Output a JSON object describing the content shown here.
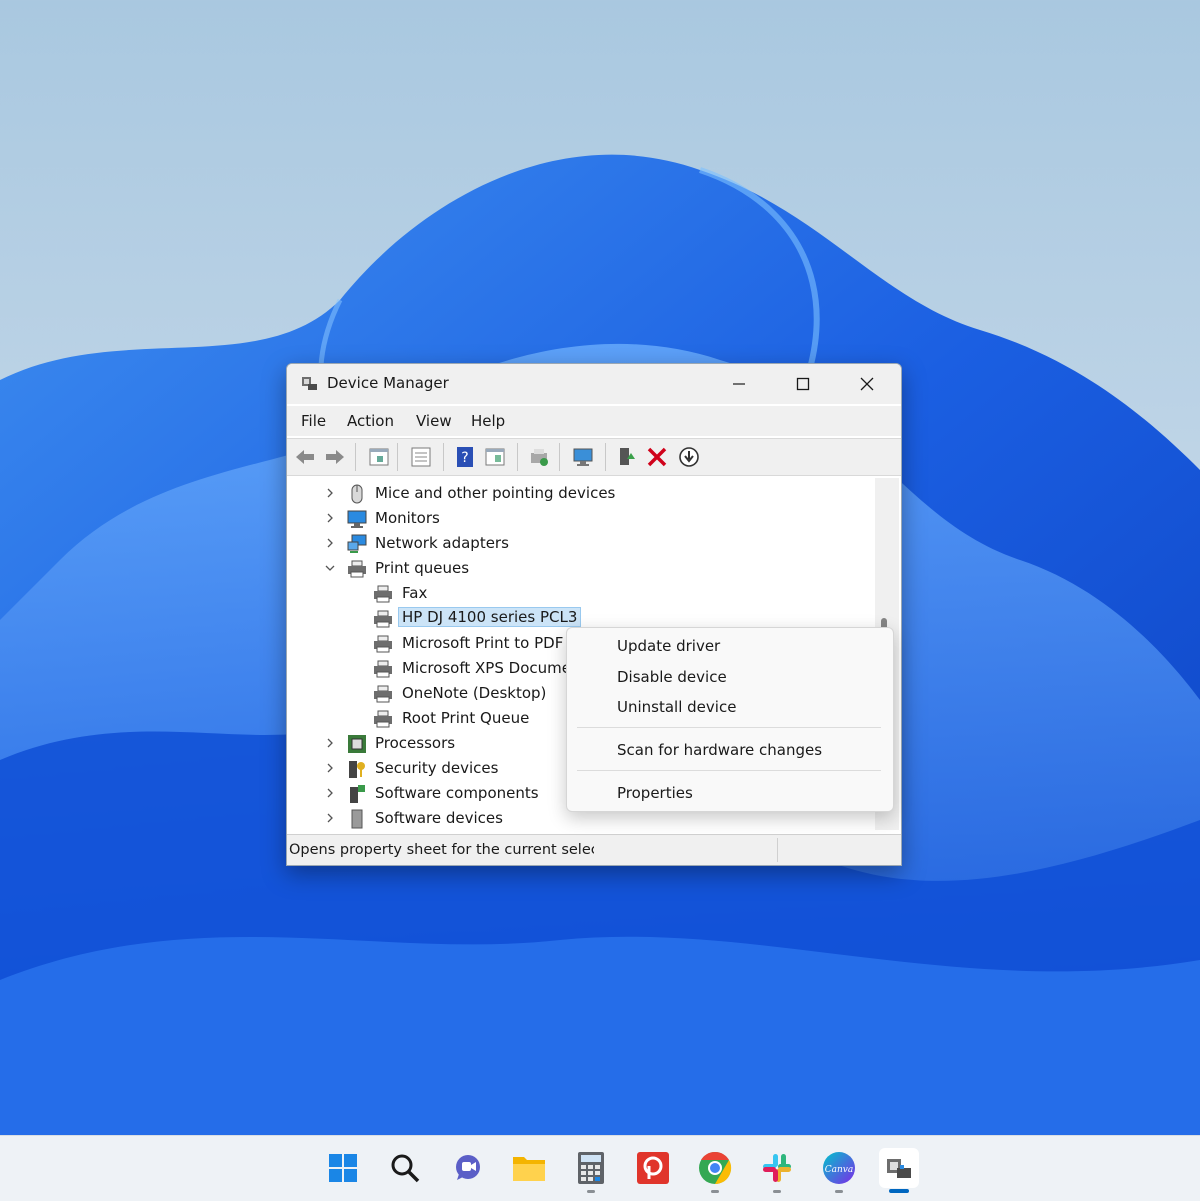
{
  "window": {
    "title": "Device Manager",
    "controls": {
      "minimize": "minimize-icon",
      "maximize": "maximize-icon",
      "close": "close-icon"
    }
  },
  "menu": [
    "File",
    "Action",
    "View",
    "Help"
  ],
  "toolbar": [
    "back-arrow-icon",
    "forward-arrow-icon",
    "properties-icon",
    "show-hide-tree-icon",
    "help-icon",
    "view-icon",
    "update-driver-icon",
    "scan-hardware-icon",
    "enable-device-icon",
    "uninstall-icon",
    "disable-device-icon"
  ],
  "tree": {
    "items": [
      {
        "label": "Mice and other pointing devices",
        "icon": "mouse-icon",
        "expanded": false,
        "level": 0
      },
      {
        "label": "Monitors",
        "icon": "monitor-icon",
        "expanded": false,
        "level": 0
      },
      {
        "label": "Network adapters",
        "icon": "network-adapter-icon",
        "expanded": false,
        "level": 0
      },
      {
        "label": "Print queues",
        "icon": "printer-icon",
        "expanded": true,
        "level": 0
      },
      {
        "label": "Fax",
        "icon": "printer-icon",
        "level": 1
      },
      {
        "label": "HP DJ 4100 series PCL3",
        "icon": "printer-icon",
        "level": 1,
        "selected": true
      },
      {
        "label": "Microsoft Print to PDF",
        "icon": "printer-icon",
        "level": 1
      },
      {
        "label": "Microsoft XPS Docume",
        "icon": "printer-icon",
        "level": 1
      },
      {
        "label": "OneNote (Desktop)",
        "icon": "printer-icon",
        "level": 1
      },
      {
        "label": "Root Print Queue",
        "icon": "printer-icon",
        "level": 1
      },
      {
        "label": "Processors",
        "icon": "processor-icon",
        "expanded": false,
        "level": 0
      },
      {
        "label": "Security devices",
        "icon": "security-device-icon",
        "expanded": false,
        "level": 0
      },
      {
        "label": "Software components",
        "icon": "software-component-icon",
        "expanded": false,
        "level": 0
      },
      {
        "label": "Software devices",
        "icon": "software-device-icon",
        "expanded": false,
        "level": 0
      }
    ]
  },
  "status": {
    "text": "Opens property sheet for the current selec"
  },
  "context_menu": {
    "items": [
      "Update driver",
      "Disable device",
      "Uninstall device",
      "Scan for hardware changes",
      "Properties"
    ]
  },
  "taskbar": {
    "apps": [
      "start-icon",
      "search-icon",
      "chat-icon",
      "file-explorer-icon",
      "calculator-icon",
      "pocket-icon",
      "chrome-icon",
      "slack-icon",
      "canva-icon",
      "device-manager-icon"
    ],
    "canva_text": "Canva"
  },
  "colors": {
    "accent": "#0067c0",
    "selection": "#cce4f7",
    "wallpaper_blue": "#1560e0"
  }
}
